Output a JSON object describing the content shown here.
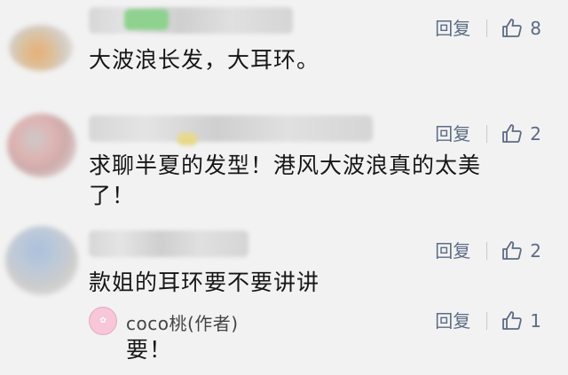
{
  "comments": [
    {
      "text": "大波浪长发，大耳环。",
      "reply_label": "回复",
      "likes": "8"
    },
    {
      "text_line1": "求聊半夏的发型！港风大波浪真的太美",
      "text_line2": "了！",
      "reply_label": "回复",
      "likes": "2"
    },
    {
      "text": "款姐的耳环要不要讲讲",
      "reply_label": "回复",
      "likes": "2"
    }
  ],
  "reply": {
    "author": "coco桃(作者)",
    "text": "要！",
    "reply_label": "回复",
    "likes": "1"
  },
  "colors": {
    "action_text": "#5b6c84",
    "background": "#f2f2f2"
  },
  "icons": {
    "like": "thumbs-up-icon"
  }
}
